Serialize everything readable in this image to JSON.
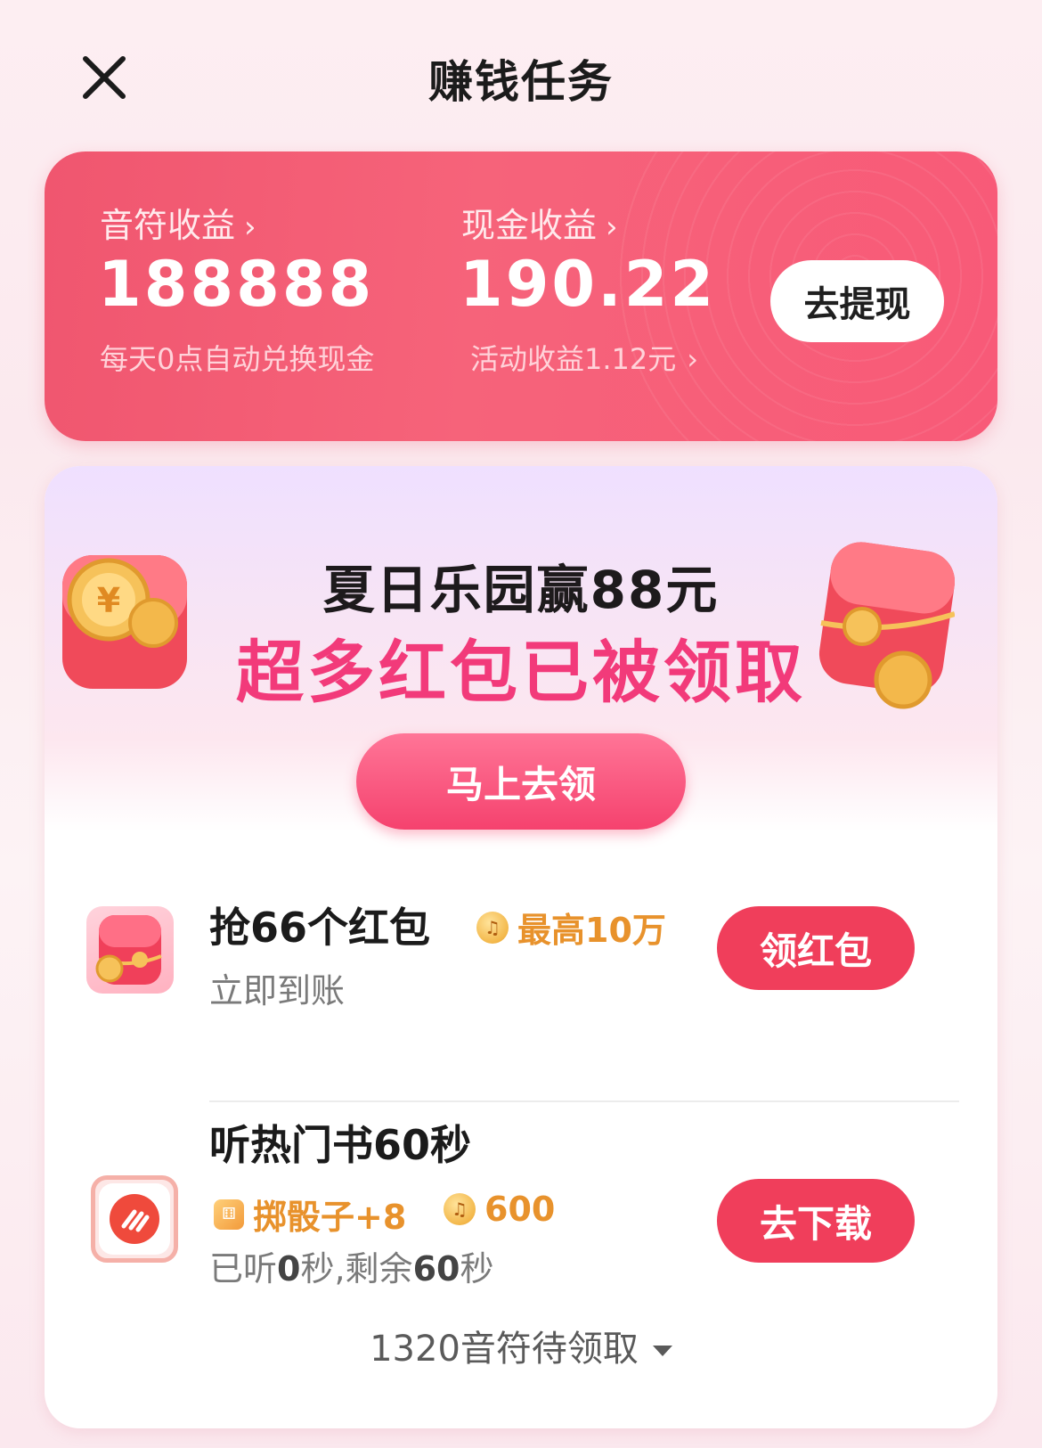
{
  "header": {
    "title": "赚钱任务"
  },
  "earnings": {
    "notes_label": "音符收益",
    "notes_value": "188888",
    "notes_sub": "每天0点自动兑换现金",
    "cash_label": "现金收益",
    "cash_value": "190.22",
    "cash_sub": "活动收益1.12元",
    "withdraw_label": "去提现",
    "chevron": "›"
  },
  "banner": {
    "title": "夏日乐园赢88元",
    "subtitle": "超多红包已被领取",
    "claim_label": "马上去领"
  },
  "tasks": [
    {
      "title": "抢66个红包",
      "reward": "最高10万",
      "subtitle": "立即到账",
      "button": "领红包"
    },
    {
      "title": "听热门书60秒",
      "reward_dice": "掷骰子+8",
      "reward_notes": "600",
      "progress_prefix": "已听",
      "listened": "0",
      "progress_mid": "秒,剩余",
      "remaining": "60",
      "progress_suffix": "秒",
      "button": "去下载"
    }
  ],
  "footer": {
    "pending": "1320音符待领取"
  },
  "icons": {
    "close": "close-icon",
    "chevron": "chevron-right-icon",
    "coin": "music-coin-icon",
    "dice": "dice-icon",
    "caret": "caret-down-icon"
  },
  "colors": {
    "accent": "#f03e5b",
    "banner_pink": "#f23a7a",
    "reward_orange": "#e8922c"
  }
}
